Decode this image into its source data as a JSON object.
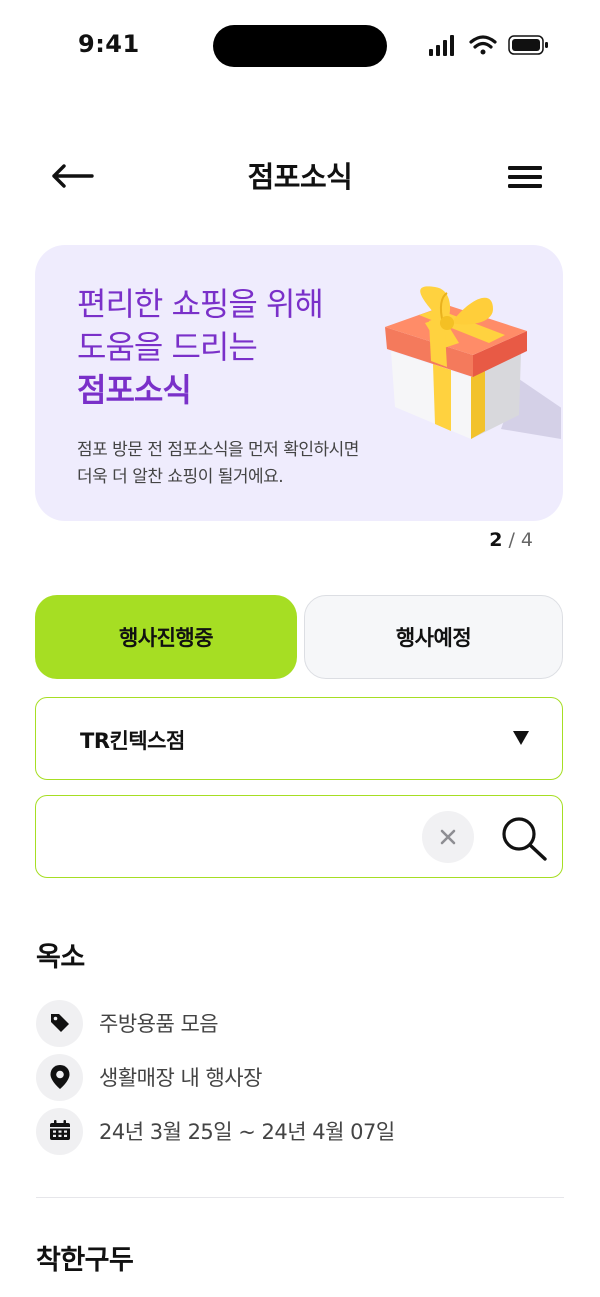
{
  "status_bar": {
    "time": "9:41",
    "icons": [
      "signal-icon",
      "wifi-icon",
      "battery-icon"
    ]
  },
  "header": {
    "title": "점포소식",
    "back_icon": "arrow-left-icon",
    "menu_icon": "hamburger-menu-icon"
  },
  "banner": {
    "title_lines": [
      "편리한 쇼핑을 위해",
      "도움을 드리는"
    ],
    "title_bold": "점포소식",
    "desc_lines": [
      "점포 방문 전 점포소식을 먼저 확인하시면",
      "더욱 더 알찬 쇼핑이 될거에요."
    ],
    "pager_current": "2",
    "pager_separator": " / ",
    "pager_total": "4",
    "background_color": "#efecfd",
    "title_color": "#7a30c9"
  },
  "tabs": {
    "active": "행사진행중",
    "inactive": "행사예정",
    "accent_color": "#a6de23"
  },
  "store_select": {
    "value": "TR킨텍스점"
  },
  "search": {
    "value": "",
    "placeholder": ""
  },
  "events": [
    {
      "title": "옥소",
      "category": "주방용품 모음",
      "location": "생활매장 내 행사장",
      "period": "24년 3월 25일 ~ 24년 4월 07일"
    },
    {
      "title": "착한구두"
    }
  ]
}
